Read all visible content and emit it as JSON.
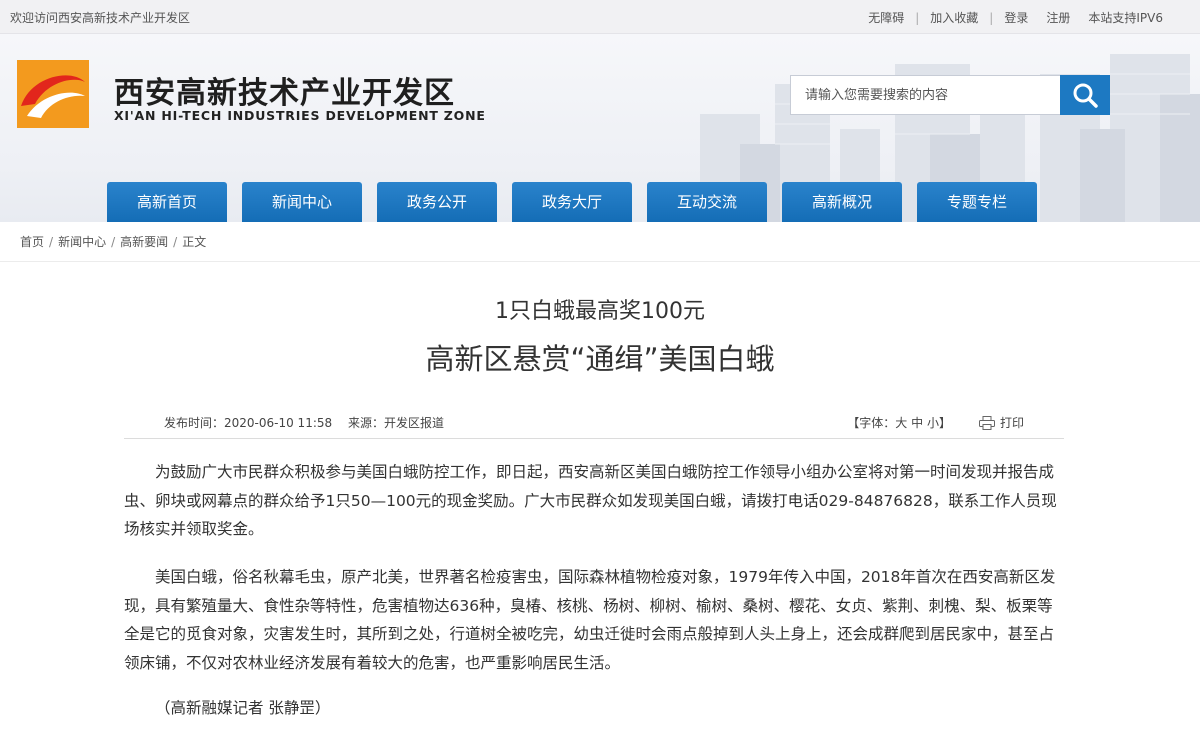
{
  "topbar": {
    "welcome": "欢迎访问西安高新技术产业开发区",
    "links": [
      "无障碍",
      "加入收藏",
      "登录",
      "注册",
      "本站支持IPV6"
    ]
  },
  "header": {
    "title_cn": "西安高新技术产业开发区",
    "title_en": "XI'AN HI-TECH INDUSTRIES DEVELOPMENT ZONE"
  },
  "search": {
    "placeholder": "请输入您需要搜索的内容"
  },
  "nav": [
    "高新首页",
    "新闻中心",
    "政务公开",
    "政务大厅",
    "互动交流",
    "高新概况",
    "专题专栏"
  ],
  "breadcrumb": [
    "首页",
    "新闻中心",
    "高新要闻",
    "正文"
  ],
  "article": {
    "subtitle": "1只白蛾最高奖100元",
    "headline": "高新区悬赏“通缉”美国白蛾",
    "publish_time": "发布时间：2020-06-10 11:58",
    "source": "来源：开发区报道",
    "font_label": "【字体：",
    "font_sizes": [
      "大",
      "中",
      "小"
    ],
    "font_close": "】",
    "print_label": "打印",
    "para1": "为鼓励广大市民群众积极参与美国白蛾防控工作，即日起，西安高新区美国白蛾防控工作领导小组办公室将对第一时间发现并报告成虫、卵块或网幕点的群众给予1只50—100元的现金奖励。广大市民群众如发现美国白蛾，请拨打电话029-84876828，联系工作人员现场核实并领取奖金。",
    "para2": "美国白蛾，俗名秋幕毛虫，原产北美，世界著名检疫害虫，国际森林植物检疫对象，1979年传入中国，2018年首次在西安高新区发现，具有繁殖量大、食性杂等特性，危害植物达636种，臭椿、核桃、杨树、柳树、榆树、桑树、樱花、女贞、紫荆、刺槐、梨、板栗等全是它的觅食对象，灾害发生时，其所到之处，行道树全被吃完，幼虫迁徙时会雨点般掉到人头上身上，还会成群爬到居民家中，甚至占领床铺，不仅对农林业经济发展有着较大的危害，也严重影响居民生活。",
    "reporter": "（高新融媒记者 张静罡）"
  },
  "colors": {
    "nav_blue": "#1a72bb",
    "logo_orange": "#f39a1e",
    "logo_red": "#e2261c"
  }
}
